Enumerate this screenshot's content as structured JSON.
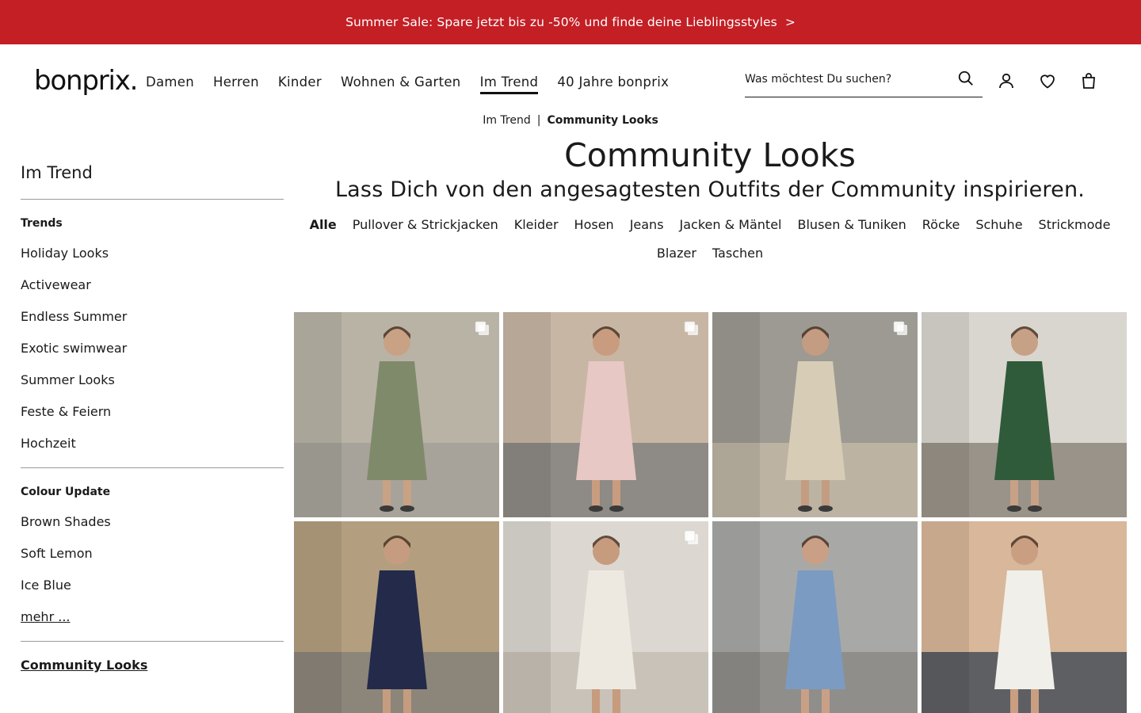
{
  "promo": {
    "text": "Summer Sale: Spare jetzt bis zu -50% und finde deine Lieblingsstyles",
    "arrow": ">"
  },
  "header": {
    "logo": "bonprix",
    "logo_dot": ".",
    "nav": [
      {
        "label": "Damen"
      },
      {
        "label": "Herren"
      },
      {
        "label": "Kinder"
      },
      {
        "label": "Wohnen & Garten"
      },
      {
        "label": "Im Trend",
        "active": true
      },
      {
        "label": "40 Jahre bonprix"
      }
    ],
    "search_placeholder": "Was möchtest Du suchen?",
    "icons": [
      "search-icon",
      "account-icon",
      "wishlist-heart-icon",
      "shopping-bag-icon"
    ]
  },
  "breadcrumb": {
    "parent": "Im Trend",
    "separator": "|",
    "current": "Community Looks"
  },
  "sidebar": {
    "title": "Im Trend",
    "groups": [
      {
        "title": "Trends",
        "items": [
          "Holiday Looks",
          "Activewear",
          "Endless Summer",
          "Exotic swimwear",
          "Summer Looks",
          "Feste & Feiern",
          "Hochzeit"
        ]
      },
      {
        "title": "Colour Update",
        "items": [
          "Brown Shades",
          "Soft Lemon",
          "Ice Blue"
        ],
        "more": "mehr ..."
      }
    ],
    "community": "Community Looks"
  },
  "main": {
    "title": "Community Looks",
    "subtitle": "Lass Dich von den angesagtesten Outfits der Community inspirieren.",
    "filters": [
      "Alle",
      "Pullover & Strickjacken",
      "Kleider",
      "Hosen",
      "Jeans",
      "Jacken & Mäntel",
      "Blusen & Tuniken",
      "Röcke",
      "Schuhe",
      "Strickmode",
      "Blazer",
      "Taschen"
    ],
    "active_filter": "Alle"
  },
  "grid": {
    "tiles": [
      {
        "name": "look-olive-dress",
        "multi": true,
        "bg": "#b9b3a6",
        "ground": "#a7a39a",
        "outfit": "#7f8a6a",
        "skin": "#c9a184"
      },
      {
        "name": "look-pink-jumpsuit",
        "multi": true,
        "bg": "#c7b6a3",
        "ground": "#8e8a85",
        "outfit": "#e7c8c4",
        "skin": "#c99c80"
      },
      {
        "name": "look-beige-skirt",
        "multi": true,
        "bg": "#9c9a92",
        "ground": "#bcb3a3",
        "outfit": "#d7ccb6",
        "skin": "#c39c82"
      },
      {
        "name": "look-floral-tunic",
        "multi": false,
        "bg": "#d9d6cf",
        "ground": "#9a9389",
        "outfit": "#2f5b3a",
        "skin": "#c7a186"
      },
      {
        "name": "look-navy-dress",
        "multi": false,
        "bg": "#b39f7f",
        "ground": "#8c857a",
        "outfit": "#232a4a",
        "skin": "#c59c80"
      },
      {
        "name": "look-white-jumpsuit",
        "multi": true,
        "bg": "#dcd8d1",
        "ground": "#c8c2b8",
        "outfit": "#eee9e0",
        "skin": "#c79b7d"
      },
      {
        "name": "look-denim-jumpsuit",
        "multi": false,
        "bg": "#a8a9a7",
        "ground": "#8f8e8a",
        "outfit": "#7c9bc2",
        "skin": "#c9a085"
      },
      {
        "name": "look-white-summer-dress",
        "multi": false,
        "bg": "#d8b79a",
        "ground": "#5e5f63",
        "outfit": "#f1efe9",
        "skin": "#c99e81"
      }
    ]
  }
}
